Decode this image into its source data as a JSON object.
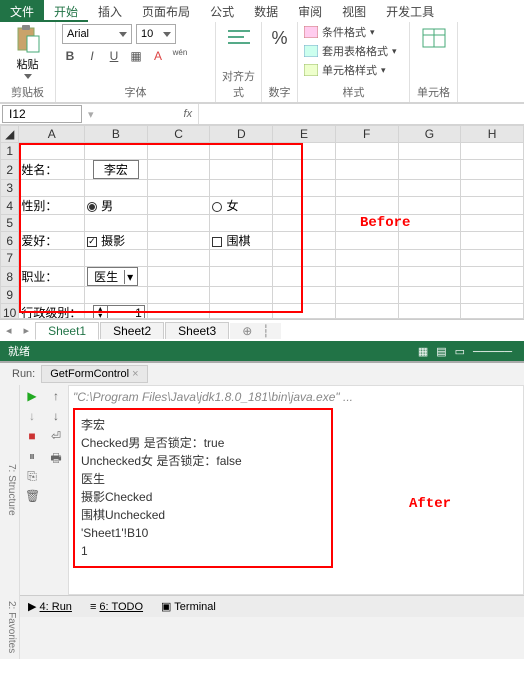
{
  "ribbon": {
    "tabs": {
      "file": "文件",
      "home": "开始",
      "insert": "插入",
      "layout": "页面布局",
      "formula": "公式",
      "data": "数据",
      "review": "审阅",
      "view": "视图",
      "dev": "开发工具"
    },
    "clipboard": {
      "paste": "粘贴",
      "label": "剪贴板"
    },
    "font": {
      "name": "Arial",
      "size": "10",
      "label": "字体"
    },
    "align": {
      "label": "对齐方式"
    },
    "number": {
      "label": "数字",
      "symbol": "%"
    },
    "styles": {
      "cond": "条件格式",
      "table": "套用表格格式",
      "cell": "单元格样式",
      "label": "样式"
    },
    "cells": {
      "label": "单元格"
    }
  },
  "namebox": {
    "ref": "I12"
  },
  "cols": [
    "A",
    "B",
    "C",
    "D",
    "E",
    "F",
    "G",
    "H"
  ],
  "form": {
    "name_label": "姓名：",
    "name_value": "李宏",
    "sex_label": "性别：",
    "male": "男",
    "female": "女",
    "hobby_label": "爱好：",
    "photo": "摄影",
    "go": "围棋",
    "job_label": "职业：",
    "job_value": "医生",
    "rank_label": "行政级别：",
    "rank_value": "1"
  },
  "annotations": {
    "before": "Before",
    "after": "After"
  },
  "sheets": {
    "s1": "Sheet1",
    "s2": "Sheet2",
    "s3": "Sheet3"
  },
  "status": {
    "ready": "就绪"
  },
  "ide": {
    "run_label": "Run:",
    "tab": "GetFormControl",
    "path": "\"C:\\Program Files\\Java\\jdk1.8.0_181\\bin\\java.exe\" ...",
    "out": {
      "l1": "李宏",
      "l2": "Checked男 是否锁定：true",
      "l3": "Unchecked女 是否锁定：false",
      "l4": "医生",
      "l5": "摄影Checked",
      "l6": "围棋Unchecked",
      "l7": "'Sheet1'!B10",
      "l8": "1"
    },
    "side1": "7: Structure",
    "side2": "2: Favorites",
    "bottom_run": "4: Run",
    "bottom_todo": "6: TODO",
    "bottom_term": "Terminal"
  }
}
